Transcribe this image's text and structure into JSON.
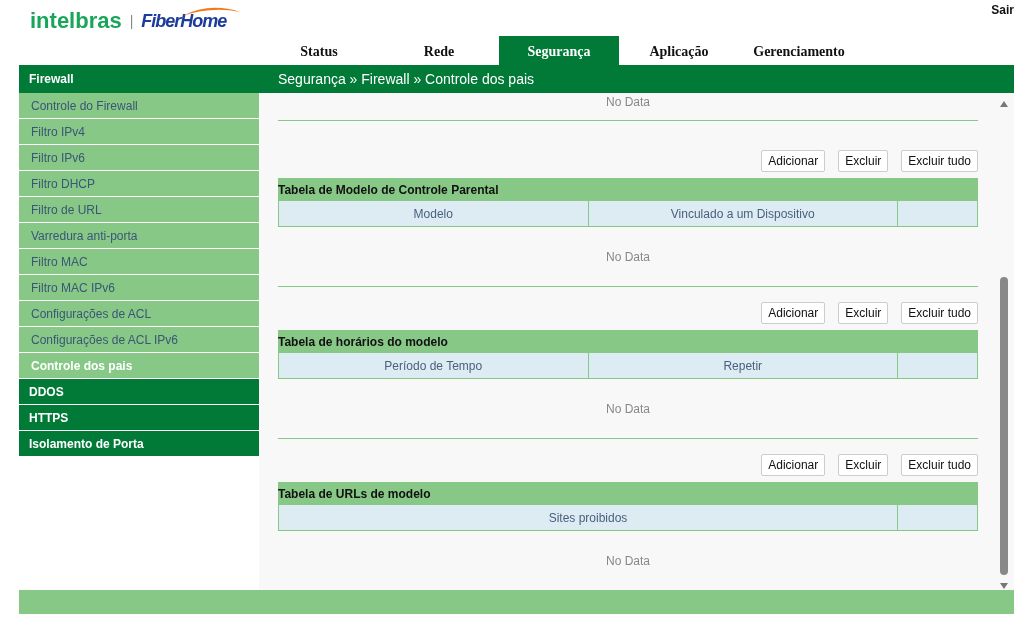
{
  "header": {
    "logo": {
      "brand": "intelbras",
      "separator": "|",
      "partner": "FiberHome"
    },
    "logout": "Sair"
  },
  "nav_tabs": [
    {
      "label": "Status",
      "selected": false
    },
    {
      "label": "Rede",
      "selected": false
    },
    {
      "label": "Segurança",
      "selected": true
    },
    {
      "label": "Aplicação",
      "selected": false
    },
    {
      "label": "Gerenciamento",
      "selected": false
    }
  ],
  "sidebar": {
    "groups": [
      {
        "label": "Firewall",
        "children": [
          {
            "label": "Controle do Firewall",
            "selected": false
          },
          {
            "label": "Filtro IPv4",
            "selected": false
          },
          {
            "label": "Filtro IPv6",
            "selected": false
          },
          {
            "label": "Filtro DHCP",
            "selected": false
          },
          {
            "label": "Filtro de URL",
            "selected": false
          },
          {
            "label": "Varredura anti-porta",
            "selected": false
          },
          {
            "label": "Filtro MAC",
            "selected": false
          },
          {
            "label": "Filtro MAC IPv6",
            "selected": false
          },
          {
            "label": "Configurações de ACL",
            "selected": false
          },
          {
            "label": "Configurações de ACL IPv6",
            "selected": false
          },
          {
            "label": "Controle dos pais",
            "selected": true
          }
        ]
      },
      {
        "label": "DDOS"
      },
      {
        "label": "HTTPS"
      },
      {
        "label": "Isolamento de Porta"
      }
    ]
  },
  "breadcrumb": "Segurança » Firewall » Controle dos pais",
  "content": {
    "partial_row": {
      "empty_text": "No Data"
    },
    "sections": [
      {
        "buttons": [
          "Adicionar",
          "Excluir",
          "Excluir tudo"
        ],
        "title": "Tabela de Modelo de Controle Parental",
        "columns": [
          "Modelo",
          "Vinculado a um Dispositivo"
        ],
        "empty_text": "No Data"
      },
      {
        "buttons": [
          "Adicionar",
          "Excluir",
          "Excluir tudo"
        ],
        "title": "Tabela de horários do modelo",
        "columns": [
          "Período de Tempo",
          "Repetir"
        ],
        "empty_text": "No Data"
      },
      {
        "buttons": [
          "Adicionar",
          "Excluir",
          "Excluir tudo"
        ],
        "title": "Tabela de URLs de modelo",
        "columns": [
          "Sites proibidos"
        ],
        "empty_text": "No Data"
      }
    ]
  }
}
